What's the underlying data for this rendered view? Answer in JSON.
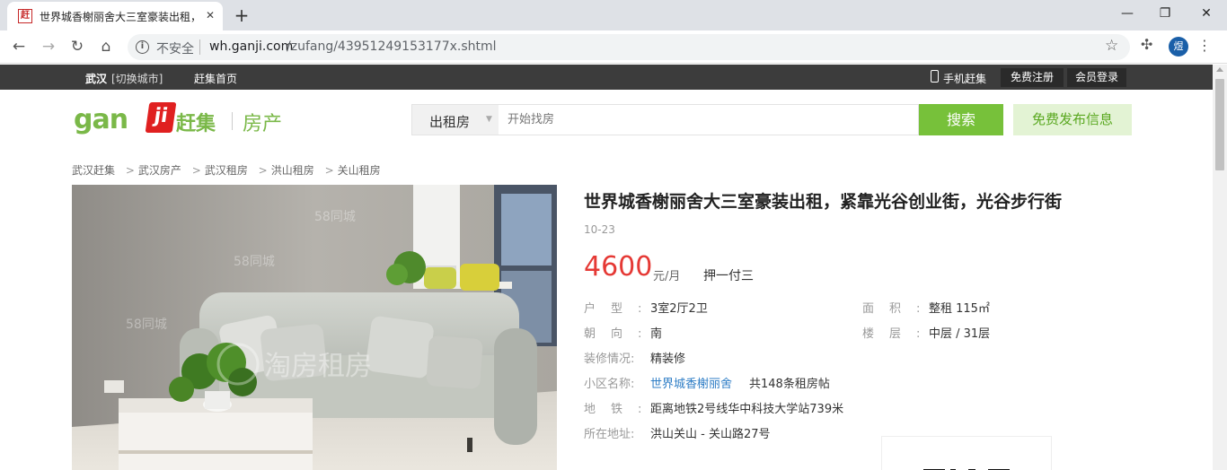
{
  "browser": {
    "tab_title": "世界城香榭丽舍大三室豪装出租，",
    "tab_favicon": "赶",
    "new_tab": "+",
    "address_security": "不安全",
    "url_host": "wh.ganji.com",
    "url_path": "/zufang/43951249153177x.shtml",
    "profile_initial": "煜"
  },
  "topnav": {
    "city": "武汉",
    "switch_city": "[切换城市]",
    "home": "赶集首页",
    "mobile": "手机赶集",
    "register": "免费注册",
    "login": "会员登录"
  },
  "logo": {
    "gan": "gan",
    "ji": "ji",
    "cn": "赶集",
    "category": "房产"
  },
  "search": {
    "category": "出租房",
    "placeholder": "开始找房",
    "button": "搜索",
    "publish": "免费发布信息"
  },
  "breadcrumb": [
    "武汉赶集",
    "武汉房产",
    "武汉租房",
    "洪山租房",
    "关山租房"
  ],
  "listing": {
    "title": "世界城香榭丽舍大三室豪装出租，紧靠光谷创业街，光谷步行街",
    "date": "10-23",
    "price": "4600",
    "price_unit": "元/月",
    "payment": "押一付三",
    "layout_label": "户型:",
    "layout_value": "3室2厅2卫",
    "area_label": "面积:",
    "area_value": "整租  115㎡",
    "orientation_label": "朝向:",
    "orientation_value": "南",
    "floor_label": "楼层:",
    "floor_value": "中层 / 31层",
    "decoration_label": "装修情况:",
    "decoration_value": "精装修",
    "community_label": "小区名称:",
    "community_value": "世界城香榭丽舍",
    "community_count": "共148条租房帖",
    "metro_label": "地铁:",
    "metro_value": "距离地铁2号线华中科技大学站739米",
    "address_label": "所在地址:",
    "address_value": "洪山关山 - 关山路27号"
  },
  "photo": {
    "watermark": "58同城",
    "watermark_center": "淘房租房"
  },
  "colors": {
    "accent_green": "#77c13a",
    "price_red": "#e53935",
    "link_blue": "#2f7ec6",
    "topnav_bg": "#3c3c3c"
  }
}
